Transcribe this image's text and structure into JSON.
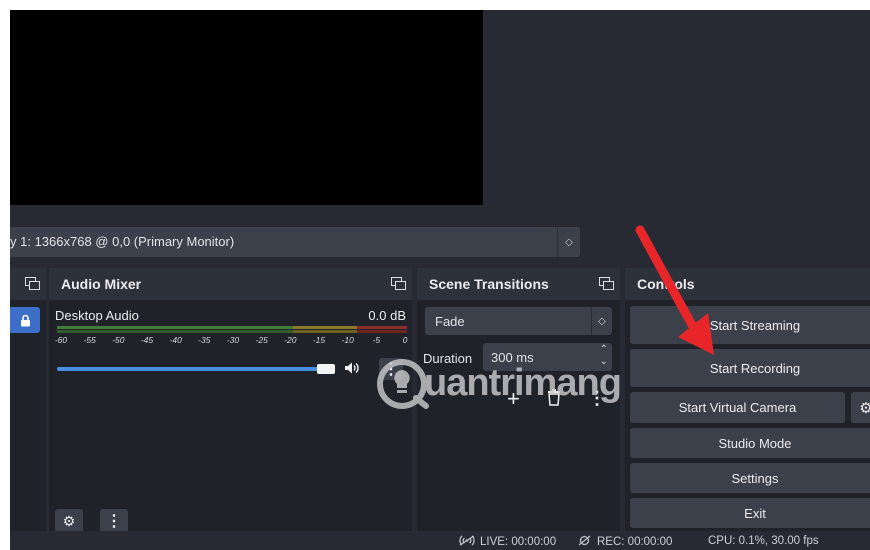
{
  "source_bar": {
    "display_text": "y 1: 1366x768 @ 0,0 (Primary Monitor)",
    "spinner_glyph": "◇"
  },
  "audio_mixer": {
    "title": "Audio Mixer",
    "channel": {
      "name": "Desktop Audio",
      "level": "0.0 dB",
      "volume_fraction": 0.97
    },
    "scale": [
      "-60",
      "-55",
      "-50",
      "-45",
      "-40",
      "-35",
      "-30",
      "-25",
      "-20",
      "-15",
      "-10",
      "-5",
      "0"
    ],
    "gear_glyph": "⚙",
    "menu_glyph": "⋮"
  },
  "scene_transitions": {
    "title": "Scene Transitions",
    "transition_value": "Fade",
    "duration_label": "Duration",
    "duration_value": "300 ms",
    "add_glyph": "+",
    "menu_glyph": "⋮"
  },
  "controls": {
    "title": "Controls",
    "buttons": {
      "start_streaming": "Start Streaming",
      "start_recording": "Start Recording",
      "start_virtual_camera": "Start Virtual Camera",
      "studio_mode": "Studio Mode",
      "settings": "Settings",
      "exit": "Exit"
    },
    "gear_glyph": "⚙"
  },
  "status_bar": {
    "live": "LIVE: 00:00:00",
    "rec": "REC: 00:00:00",
    "cpu": "CPU: 0.1%, 30.00 fps"
  },
  "watermark": {
    "text": "uantrimang"
  },
  "colors": {
    "accent": "#3d6fc9",
    "slider": "#4a90e2",
    "arrow": "#e8262a",
    "meter_green": "#4caf50",
    "meter_yellow": "#c9a227",
    "meter_red": "#c0392b"
  }
}
